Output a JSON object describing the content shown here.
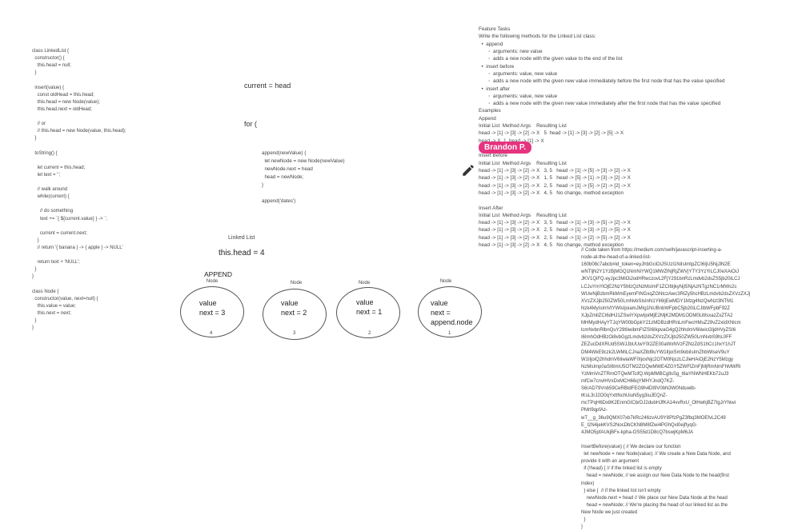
{
  "code_left": "class LinkedList {\n  constructor() {\n    this.head = null;\n  }\n\n  insert(value) {\n    const oldHead = this.head;\n    this.head = new Node(value);\n    this.head.next = oldHead;\n\n    // or\n    // this.head = new Node(value, this.head);\n  }\n\n  toString() {\n\n    let current = this.head;\n    let text = '';\n\n    // walk around\n    while(current) {\n\n      // do something\n      text += `{ ${current.value} } -> `;\n\n      current = current.next;\n    }\n    // return '{ banana } -> { apple } -> NULL'\n\n    return text + 'NULL';\n  }\n}\n\nclass Node {\n  constructor(value, next=null) {\n    this.value = value;\n    this.next = next;\n  }\n}",
  "mid_top": "current = head\n\nfor (",
  "mid_append": "append(newValue) {\n  let newNode = new Node(newValue)\n  newNode.next = head\n  head = newNode;\n}\n\nappend('dates')",
  "linked_list": {
    "title": "Linked List",
    "head_text": "this.head = 4",
    "append_label": "APPEND"
  },
  "nodes": [
    {
      "label": "Node",
      "text": "value\nnext = 3",
      "index": "4"
    },
    {
      "label": "Node",
      "text": "value\nnext = 2",
      "index": "3"
    },
    {
      "label": "Node",
      "text": "value\nnext = 1",
      "index": "2"
    },
    {
      "label": "Node",
      "text": "value\nnext =\nappend.node",
      "index": "1"
    }
  ],
  "features": "Feature Tasks\nWrite the following methods for the Linked List class:\n  •  append\n       ◦  arguments: new value\n       ◦  adds a new node with the given value to the end of the list\n  •  insert before\n       ◦  arguments: value, new value\n       ◦  adds a new node with the given new value immediately before the first node that has the value specified\n  •  insert after\n       ◦  arguments: value, new value\n       ◦  adds a new node with the given new value immediately after the first node that has the value specified\nExamples\nAppend\nInitial List  Method Args    Resulting List\nhead -> [1] -> [3] -> [2] -> X   5  head -> [1] -> [3] -> [2] -> [5] -> X\nhead -> X  1  head -> [1] -> X\n\nInsert Before\nInitial List  Method Args    Resulting List\nhead -> [1] -> [3] -> [2] -> X   3, 5   head -> [1] -> [5] -> [3] -> [2] -> X\nhead -> [1] -> [3] -> [2] -> X   1, 5   head -> [5] -> [1] -> [3] -> [2] -> X\nhead -> [1] -> [3] -> [2] -> X   2, 5   head -> [1] -> [5] -> [2] -> [2] -> X\nhead -> [1] -> [3] -> [2] -> X   4, 5   No change, method exception\n\nInsert After\nInitial List  Method Args    Resulting List\nhead -> [1] -> [3] -> [2] -> X   3, 5   head -> [1] -> [3] -> [5] -> [2] -> X\nhead -> [1] -> [3] -> [2] -> X   2, 5   head -> [1] -> [3] -> [2] -> [5] -> X\nhead -> [1] -> [3] -> [2] -> X   2, 5   head -> [1] -> [2] -> [5] -> [2] -> X\nhead -> [1] -> [3] -> [2] -> X   4, 5   No change, method exception",
  "collaborator_badge": "Brandon P.",
  "code_right": "// Code taken from https://medium.com/swlh/javascript-inserting-a-\nnode-at-the-head-of-a-linked-list-\n160b08c7abcb#id_token=eyJhbGciOiJSUzI1NiIsImtpZCI6IjU5NjJlN2E\nwNTljN2Y1YzBjMGQ1NmNiYWQ1MWZlNjRjZWVjYTY3YzYiLCJ0eXAiOiJ\nJKV1QiFQ.eyJpc3MiOiJodHRwczovL2FjY291bnRzLmdvb2dsZS5jb20iLCJ\nLCJuYmYiOjE2NzY5MzQzNzMsImF1ZCI6IjkyNjI5NjAzNTgzNC1rMWs2c\nWUwNjBzbmRkMmEyemFtNGxqZGNtczAwc3RlZy5hcHBzLmdvb2dsZXVzZXJj\nXVzZXJjb250ZW50LmNvbSIsInN1YiI6IjEwMDY1Mzg4NzQwNzI3NTM1\nNzk4MyIsImVtYWlsIjoiamJMIg1NUBnbWFpbC5jb20iLCJlbWFpbF92Z\nXJpZmllZCI6dHJ1ZSwiYXpwIjoiMjE2MjK2MDM1ODM0LWsxazZxZTA2\nMHMydHAyYTJqYW00bGpkY21zMDBzdHRnLmFwcHMuZ29vZ2xldXNlcm\nlcmNvbnRlbnQuY29tIiwibmFtZSI6IkpvaG4gQ2hhdmV6IiwicGljdHVyZSI6\nI6ImhOdHBzOi8vbGgzLmdvb2dsZXVzZXJjb250ZW50LmNvbS9hL0FF\nZEZucDdXRUd5SWJJbUUwY0I2ZE00aWxNVzFZNzZdS1hCc1hxY1hJT\nDM4WkE9czk2LWMiLCJnaXZlbl9uYW1lIjoiSm9obiIsImZhbWlseV9uY\nW1lIjoiQ2hhdmV6IiwiaWF0IjoxNjc2OTM0NjczLCJleHAiOjE2NzY5Mzgy\nNzMsImp0aSI6ImU5OTM2ZGQwMWE4ZGY5ZWFlZmFjMjRmNmFhMWRi\nYzMmVnZTRmOTQwMTcifQ.WpMMBCgllsSg_t6aYNWNHEKb72uJ3\nmfCw7cnvlHVxDxMCH66qYMHYJndQ7KZ-\nS6rAD79Vnb59CeRBtdFEG9h4Dt9V0bN3W0Nduwlb-\ntKsL3rJ2O0qYxttNchUiuN5yg3iuJEQnZ-\nmcTPqH6Dx8K2EnmGICbrDJ2dubHJfKA14vvRxU_OlHwhjBZ7tgJrYhiwi\nPMrl9qpfAz-\nwT__g_36u9QMX07xb7kRc246zvAU9Y8PfzPgZ3fbq3MOEfvL2C49\nE_I2N4jekKVS2NocDbCKN8M8fZwi4PGhQxl0ejfIyqG-\n4JMO5pfAUkjBFx-kpha-OS55d1D8cQ7bswjKpM6JA\n\nInsertBefore(value) { // We declare our function\n  let newNode = new Node(value); // We create a New Data Node, and\nprovide it with an argument\n  if (!head) { // if the linked list is empty\n    head = newNode; // we assign our New Data Node to the head(first\nindex)\n  } else {  // if the linked list isn't empty\n    newNode.next = head // We place our New Data Node at the head\n    head = newNode; // We're placing the head of our linked list as the\nNew Node we just created\n  }\n}"
}
